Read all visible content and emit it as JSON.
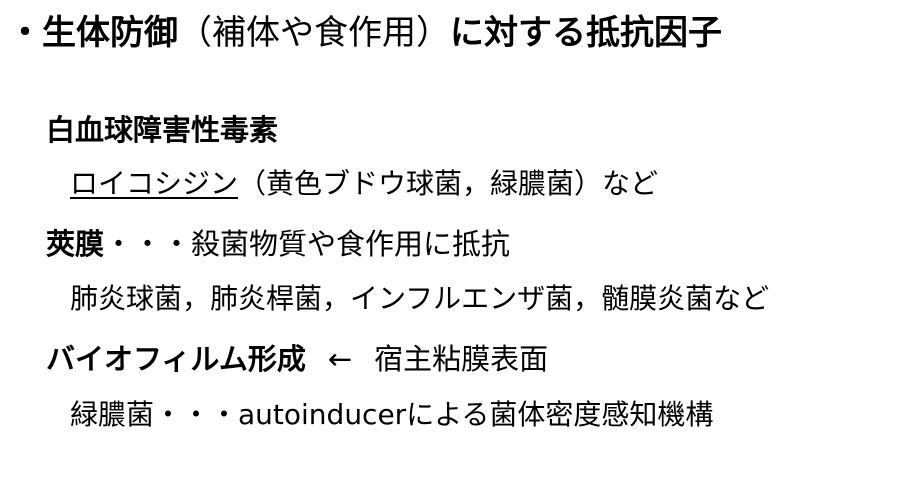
{
  "title": {
    "prefix": "・生体防御",
    "paren": "（補体や食作用）",
    "suffix": "に対する抵抗因子"
  },
  "sections": [
    {
      "heading": "白血球障害性毒素",
      "body_underlined": "ロイコシジン",
      "body_rest": "（黄色ブドウ球菌，緑膿菌）など"
    },
    {
      "heading": "莢膜",
      "heading_rest": "・・・殺菌物質や食作用に抵抗",
      "body": "肺炎球菌，肺炎桿菌，インフルエンザ菌，髄膜炎菌など"
    },
    {
      "heading": "バイオフィルム形成",
      "arrow": "←",
      "heading_rest": "宿主粘膜表面",
      "body": "緑膿菌・・・autoinducerによる菌体密度感知機構"
    }
  ]
}
